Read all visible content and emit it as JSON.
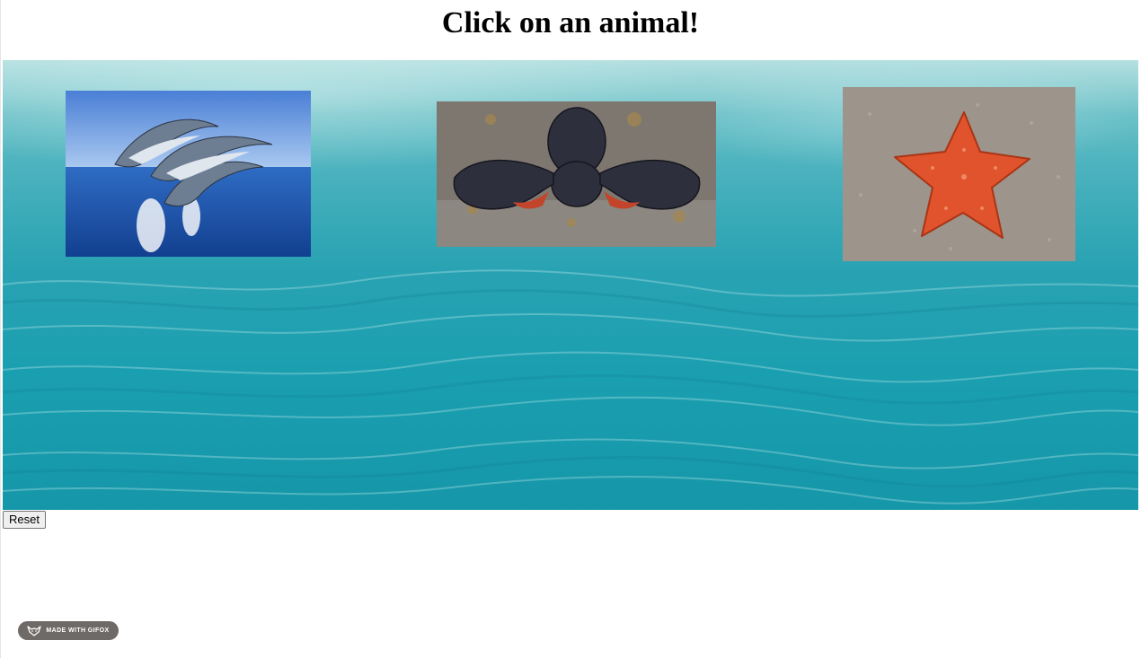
{
  "page": {
    "title": "Click on an animal!"
  },
  "scene": {
    "background": "underwater-ocean",
    "animals": [
      {
        "name": "dolphins",
        "icon": "dolphins-image"
      },
      {
        "name": "lobster",
        "icon": "lobster-image"
      },
      {
        "name": "starfish",
        "icon": "starfish-image"
      }
    ]
  },
  "controls": {
    "reset_label": "Reset"
  },
  "badge": {
    "text": "MADE WITH GIFOX",
    "icon": "fox-icon"
  },
  "colors": {
    "water": "#1a9fb0",
    "starfish": "#e0532c",
    "badge_bg": "#6e6a67"
  }
}
